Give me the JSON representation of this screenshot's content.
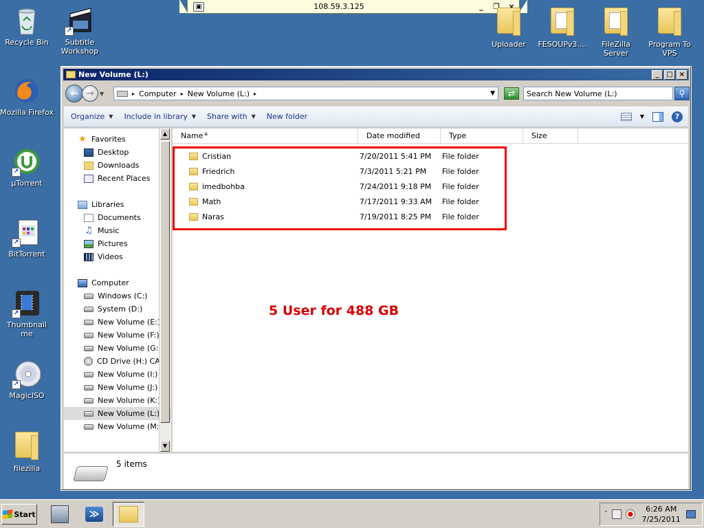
{
  "rdp": {
    "host": "108.59.3.125",
    "min": "_",
    "restore": "❐",
    "close": "×"
  },
  "desktop": {
    "icons": [
      {
        "label": "Recycle Bin"
      },
      {
        "label": "Subtitle Workshop"
      },
      {
        "label": "Mozilla Firefox"
      },
      {
        "label": "µTorrent"
      },
      {
        "label": "BitTorrent"
      },
      {
        "label": "Thumbnail me"
      },
      {
        "label": "MagicISO"
      },
      {
        "label": "filezilla"
      },
      {
        "label": "Uploader"
      },
      {
        "label": "FESOUPv3...."
      },
      {
        "label": "FileZilla Server"
      },
      {
        "label": "Program To VPS"
      }
    ]
  },
  "window": {
    "title": "New Volume (L:)",
    "breadcrumb": [
      "Computer",
      "New Volume (L:)"
    ],
    "search_placeholder": "Search New Volume (L:)",
    "toolbar": {
      "organize": "Organize",
      "include": "Include in library",
      "share": "Share with",
      "new_folder": "New folder"
    },
    "nav": {
      "favorites": "Favorites",
      "favorites_items": [
        "Desktop",
        "Downloads",
        "Recent Places"
      ],
      "libraries": "Libraries",
      "libraries_items": [
        "Documents",
        "Music",
        "Pictures",
        "Videos"
      ],
      "computer": "Computer",
      "drives": [
        "Windows (C:)",
        "System (D:)",
        "New Volume (E:)",
        "New Volume (F:)",
        "New Volume (G:)",
        "CD Drive (H:) CARS",
        "New Volume (I:)",
        "New Volume (J:)",
        "New Volume (K:)",
        "New Volume (L:)",
        "New Volume (M:)"
      ],
      "selected_drive_index": 9
    },
    "columns": [
      "Name",
      "Date modified",
      "Type",
      "Size"
    ],
    "files": [
      {
        "name": "Cristian",
        "date": "7/20/2011 5:41 PM",
        "type": "File folder"
      },
      {
        "name": "Friedrich",
        "date": "7/3/2011 5:21 PM",
        "type": "File folder"
      },
      {
        "name": "imedbohba",
        "date": "7/24/2011 9:18 PM",
        "type": "File folder"
      },
      {
        "name": "Math",
        "date": "7/17/2011 9:33 AM",
        "type": "File folder"
      },
      {
        "name": "Naras",
        "date": "7/19/2011 8:25 PM",
        "type": "File folder"
      }
    ],
    "annotation": "5 User for 488 GB",
    "status": "5 items"
  },
  "taskbar": {
    "start": "Start",
    "time": "6:26 AM",
    "date": "7/25/2011"
  }
}
